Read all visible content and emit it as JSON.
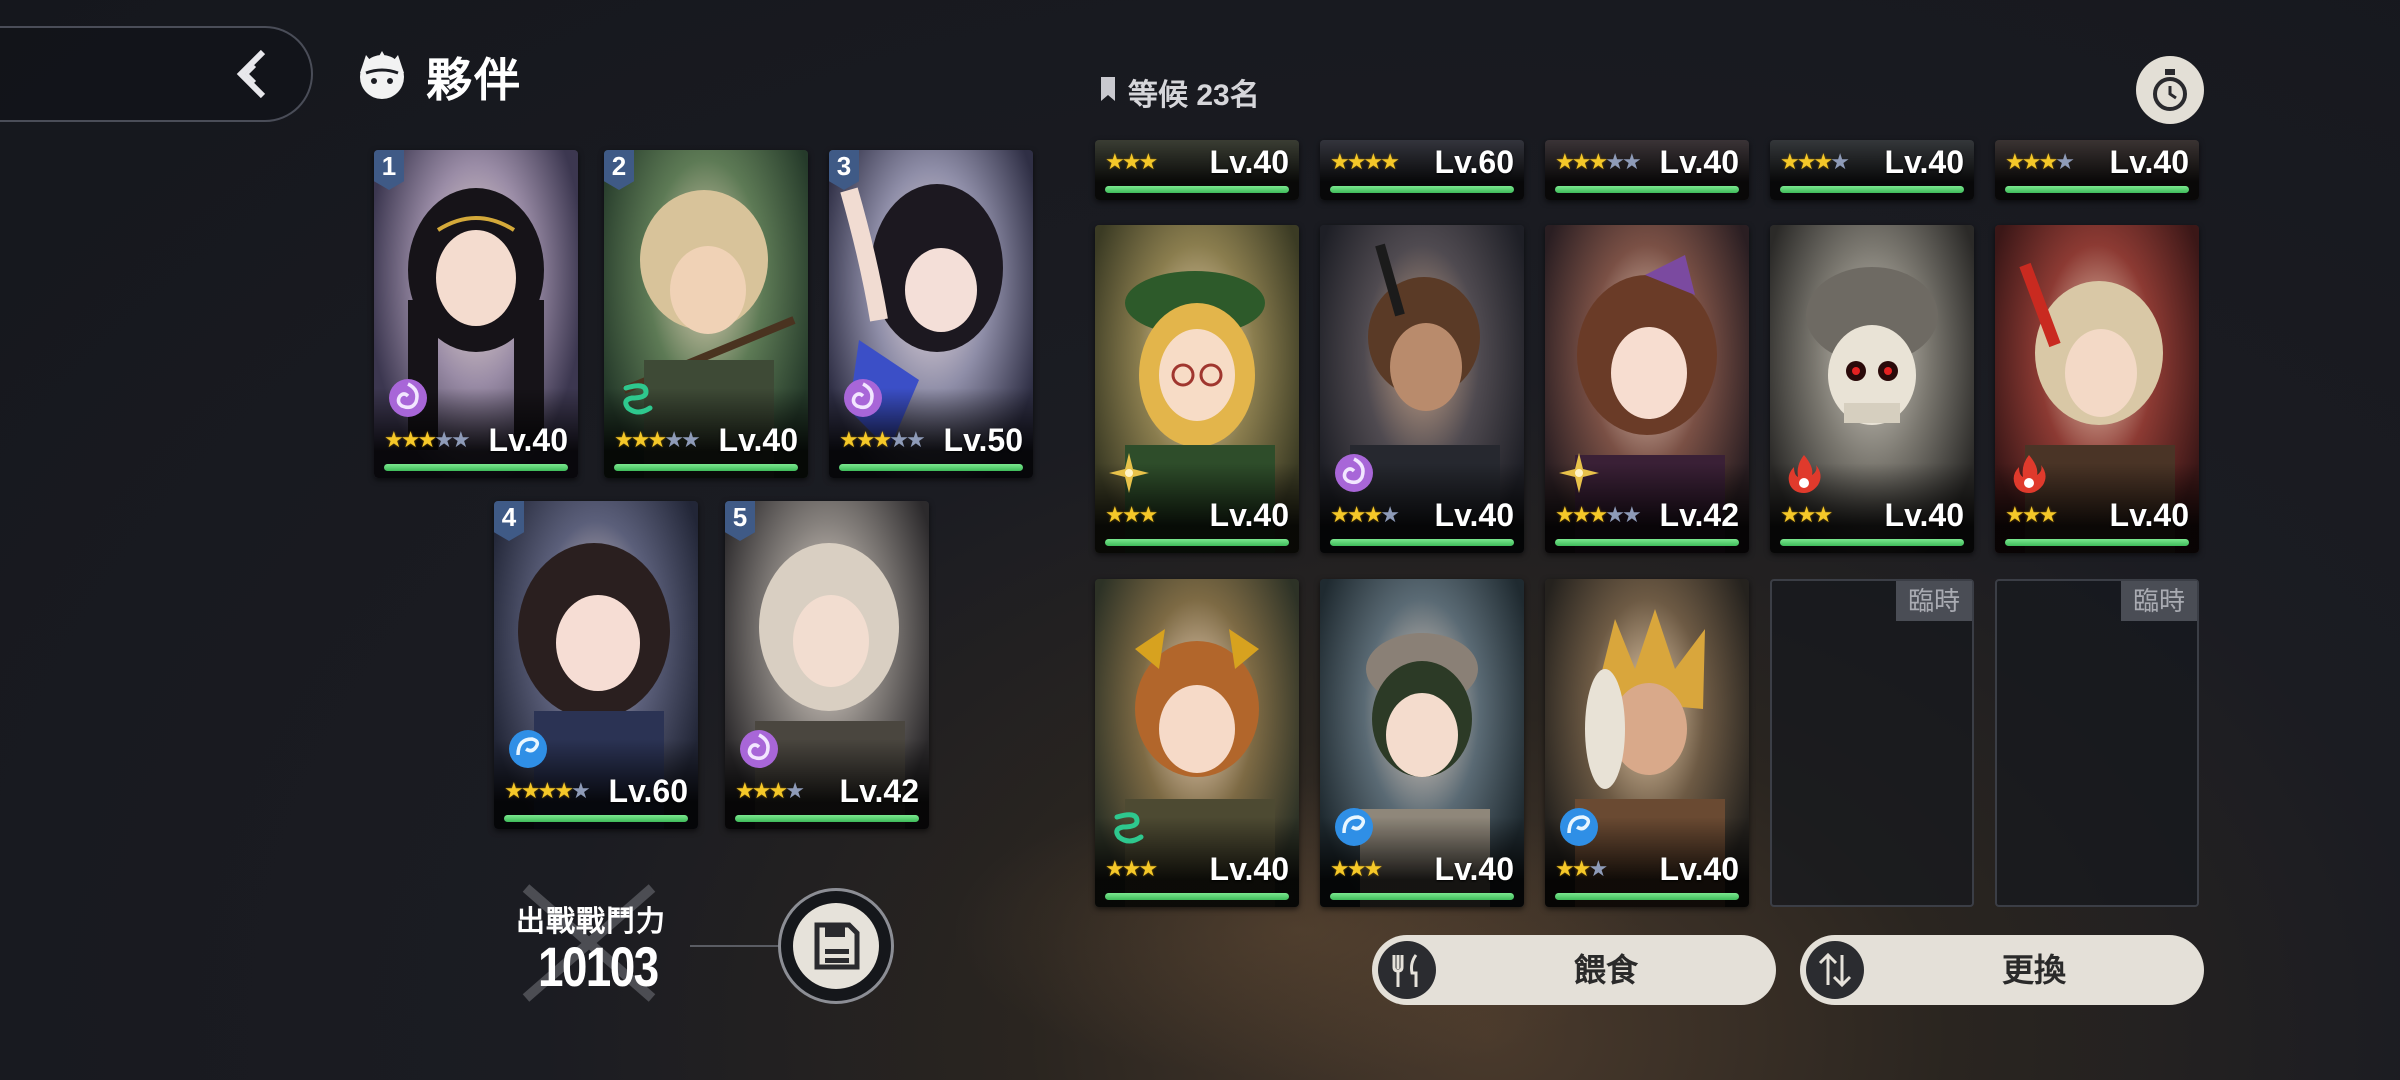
{
  "header": {
    "title": "夥伴",
    "waiting_label": "等候 23名"
  },
  "colors": {
    "star_on": "#f5c829",
    "star_off": "#8e9bb8",
    "hp_fill": "#3fbb5a",
    "button_bg": "#e4e0d8"
  },
  "party": [
    {
      "slot": "1",
      "level": "Lv.40",
      "stars_filled": 3,
      "stars_total": 5,
      "element": "psychic-swirl-icon",
      "hp": 1.0
    },
    {
      "slot": "2",
      "level": "Lv.40",
      "stars_filled": 3,
      "stars_total": 5,
      "element": "wind-swirl-icon",
      "hp": 1.0
    },
    {
      "slot": "3",
      "level": "Lv.50",
      "stars_filled": 3,
      "stars_total": 5,
      "element": "psychic-swirl-icon",
      "hp": 1.0
    },
    {
      "slot": "4",
      "level": "Lv.60",
      "stars_filled": 4,
      "stars_total": 5,
      "element": "water-wave-icon",
      "hp": 1.0
    },
    {
      "slot": "5",
      "level": "Lv.42",
      "stars_filled": 3,
      "stars_total": 4,
      "element": "psychic-swirl-icon",
      "hp": 1.0
    }
  ],
  "roster_top": [
    {
      "level": "Lv.40",
      "stars_filled": 3,
      "stars_total": 3
    },
    {
      "level": "Lv.60",
      "stars_filled": 4,
      "stars_total": 4
    },
    {
      "level": "Lv.40",
      "stars_filled": 3,
      "stars_total": 5
    },
    {
      "level": "Lv.40",
      "stars_filled": 3,
      "stars_total": 4
    },
    {
      "level": "Lv.40",
      "stars_filled": 3,
      "stars_total": 4
    }
  ],
  "roster_mid": [
    {
      "level": "Lv.40",
      "stars_filled": 3,
      "stars_total": 3,
      "element": "light-sparkle-icon"
    },
    {
      "level": "Lv.40",
      "stars_filled": 3,
      "stars_total": 4,
      "element": "psychic-swirl-icon"
    },
    {
      "level": "Lv.42",
      "stars_filled": 3,
      "stars_total": 5,
      "element": "light-sparkle-icon"
    },
    {
      "level": "Lv.40",
      "stars_filled": 3,
      "stars_total": 3,
      "element": "fire-flame-icon"
    },
    {
      "level": "Lv.40",
      "stars_filled": 3,
      "stars_total": 3,
      "element": "fire-flame-icon"
    }
  ],
  "roster_bottom": [
    {
      "level": "Lv.40",
      "stars_filled": 3,
      "stars_total": 3,
      "element": "wind-swirl-icon"
    },
    {
      "level": "Lv.40",
      "stars_filled": 3,
      "stars_total": 3,
      "element": "water-wave-icon"
    },
    {
      "level": "Lv.40",
      "stars_filled": 2,
      "stars_total": 3,
      "element": "water-wave-icon"
    }
  ],
  "empty_slots": [
    {
      "tag": "臨時"
    },
    {
      "tag": "臨時"
    }
  ],
  "power": {
    "label": "出戰戰鬥力",
    "value": "10103"
  },
  "actions": {
    "feed_label": "餵食",
    "swap_label": "更換"
  }
}
